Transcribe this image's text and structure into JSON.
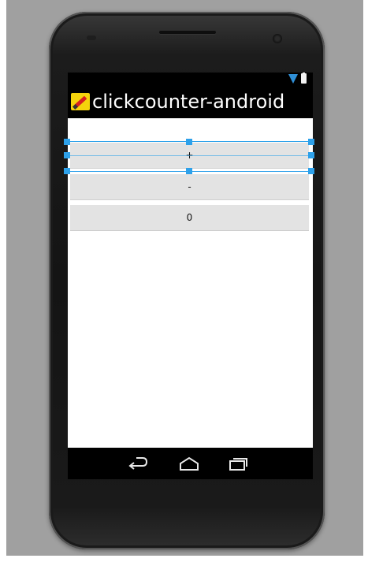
{
  "app": {
    "title": "clickcounter-android",
    "icon": "pencil-app-icon"
  },
  "status_bar": {
    "icons": [
      "wifi-icon",
      "battery-icon"
    ],
    "wifi_color": "#2f8fd6"
  },
  "buttons": {
    "increment_label": "+",
    "decrement_label": "-",
    "count_label": "0"
  },
  "navigation": {
    "items": [
      "back-icon",
      "home-icon",
      "recent-apps-icon"
    ]
  },
  "selection": {
    "selected_element": "increment-button",
    "color": "#2ea1ea"
  },
  "colors": {
    "canvas": "#a0a0a0",
    "button": "#e3e3e3",
    "screen_background": "#ffffff",
    "bars": "#000000"
  }
}
